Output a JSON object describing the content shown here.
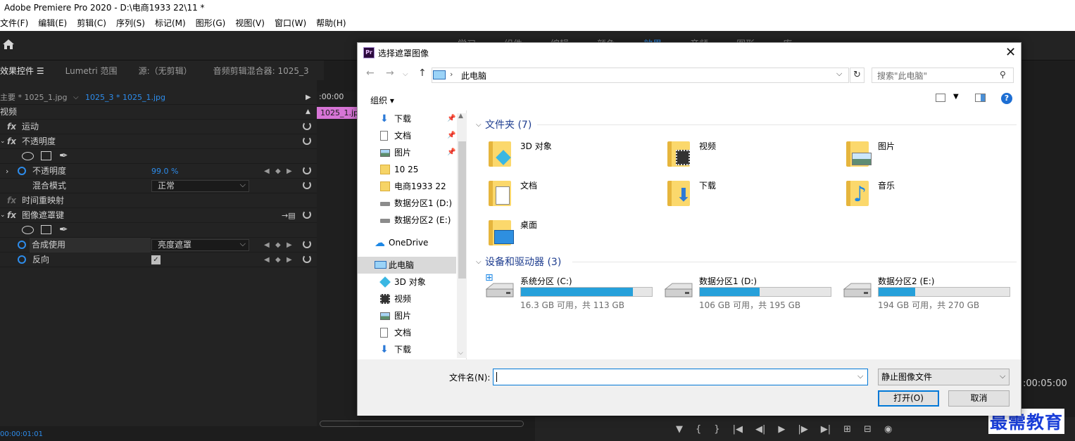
{
  "app": {
    "title": "Adobe Premiere Pro 2020 - D:\\电商1933 22\\11 *",
    "menu": [
      "文件(F)",
      "编辑(E)",
      "剪辑(C)",
      "序列(S)",
      "标记(M)",
      "图形(G)",
      "视图(V)",
      "窗口(W)",
      "帮助(H)"
    ],
    "workspace_tabs": [
      "学习",
      "组件",
      "编辑",
      "颜色",
      "效果",
      "音频",
      "图形",
      "库"
    ]
  },
  "panel_tabs": {
    "effect_controls": "效果控件",
    "lumetri": "Lumetri 范围",
    "source": "源:（无剪辑）",
    "audio_mixer": "音频剪辑混合器: 1025_3"
  },
  "effect_controls": {
    "master_clip": "主要 * 1025_1.jpg",
    "sequence_clip": "1025_3 * 1025_1.jpg",
    "timeline_time": ":00:00",
    "timeline_clip": "1025_1.jpg",
    "section_video": "视频",
    "motion": "运动",
    "opacity": "不透明度",
    "opacity_prop": "不透明度",
    "opacity_value": "99.0 %",
    "blend_mode_label": "混合模式",
    "blend_mode_value": "正常",
    "time_remap": "时间重映射",
    "track_matte": "图像遮罩键",
    "composite_label": "合成使用",
    "composite_value": "亮度遮罩",
    "reverse_label": "反向",
    "bottom_time": "00:00:01:01"
  },
  "program": {
    "time": ":00:05:00"
  },
  "watermark": "最需教育",
  "dialog": {
    "title": "选择遮罩图像",
    "icon_text": "Pr",
    "address": "此电脑",
    "search_placeholder": "搜索\"此电脑\"",
    "organize": "组织 ▾",
    "nav_items": [
      {
        "label": "下载"
      },
      {
        "label": "文档"
      },
      {
        "label": "图片"
      },
      {
        "label": "10 25"
      },
      {
        "label": "电商1933 22"
      },
      {
        "label": "数据分区1 (D:)"
      },
      {
        "label": "数据分区2 (E:)"
      },
      {
        "label": "OneDrive"
      },
      {
        "label": "此电脑"
      },
      {
        "label": "3D 对象"
      },
      {
        "label": "视频"
      },
      {
        "label": "图片"
      },
      {
        "label": "文档"
      },
      {
        "label": "下载"
      }
    ],
    "folders_header": "文件夹 (7)",
    "folders": [
      "3D 对象",
      "视频",
      "图片",
      "文档",
      "下载",
      "音乐",
      "桌面"
    ],
    "drives_header": "设备和驱动器 (3)",
    "drives": [
      {
        "name": "系统分区 (C:)",
        "free": "16.3 GB 可用，共 113 GB",
        "used_fraction": 0.856
      },
      {
        "name": "数据分区1 (D:)",
        "free": "106 GB 可用，共 195 GB",
        "used_fraction": 0.456
      },
      {
        "name": "数据分区2 (E:)",
        "free": "194 GB 可用，共 270 GB",
        "used_fraction": 0.281
      }
    ],
    "filename_label": "文件名(N):",
    "filename_value": "",
    "filetype": "静止图像文件",
    "open_label": "打开(O)",
    "cancel_label": "取消"
  }
}
